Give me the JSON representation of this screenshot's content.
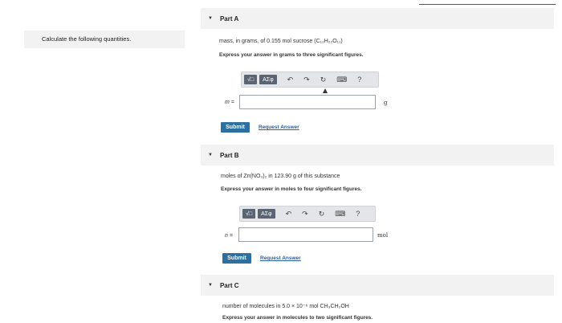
{
  "left_prompt": "Calculate the following quantities.",
  "parts": [
    {
      "header": "Part A",
      "question": "mass, in grams, of 0.155 mol sucrose (C₁₂H₂₂O₁₁)",
      "instruction": "Express your answer in grams to three significant figures.",
      "variable": "m =",
      "unit": "g",
      "submit": "Submit",
      "request": "Request Answer"
    },
    {
      "header": "Part B",
      "question": "moles of Zn(NO₃)₂ in 123.90 g of this substance",
      "instruction": "Express your answer in moles to four significant figures.",
      "variable": "n =",
      "unit": "mol",
      "submit": "Submit",
      "request": "Request Answer"
    },
    {
      "header": "Part C",
      "question": "number of molecules in 5.0 × 10⁻⁶ mol CH₃CH₂OH",
      "instruction": "Express your answer in molecules to two significant figures."
    }
  ],
  "toolbar": {
    "template_btn": "√□",
    "greek_btn": "AΣφ",
    "undo": "↶",
    "redo": "↷",
    "reset": "↻",
    "keyboard": "⌨",
    "help": "?"
  }
}
